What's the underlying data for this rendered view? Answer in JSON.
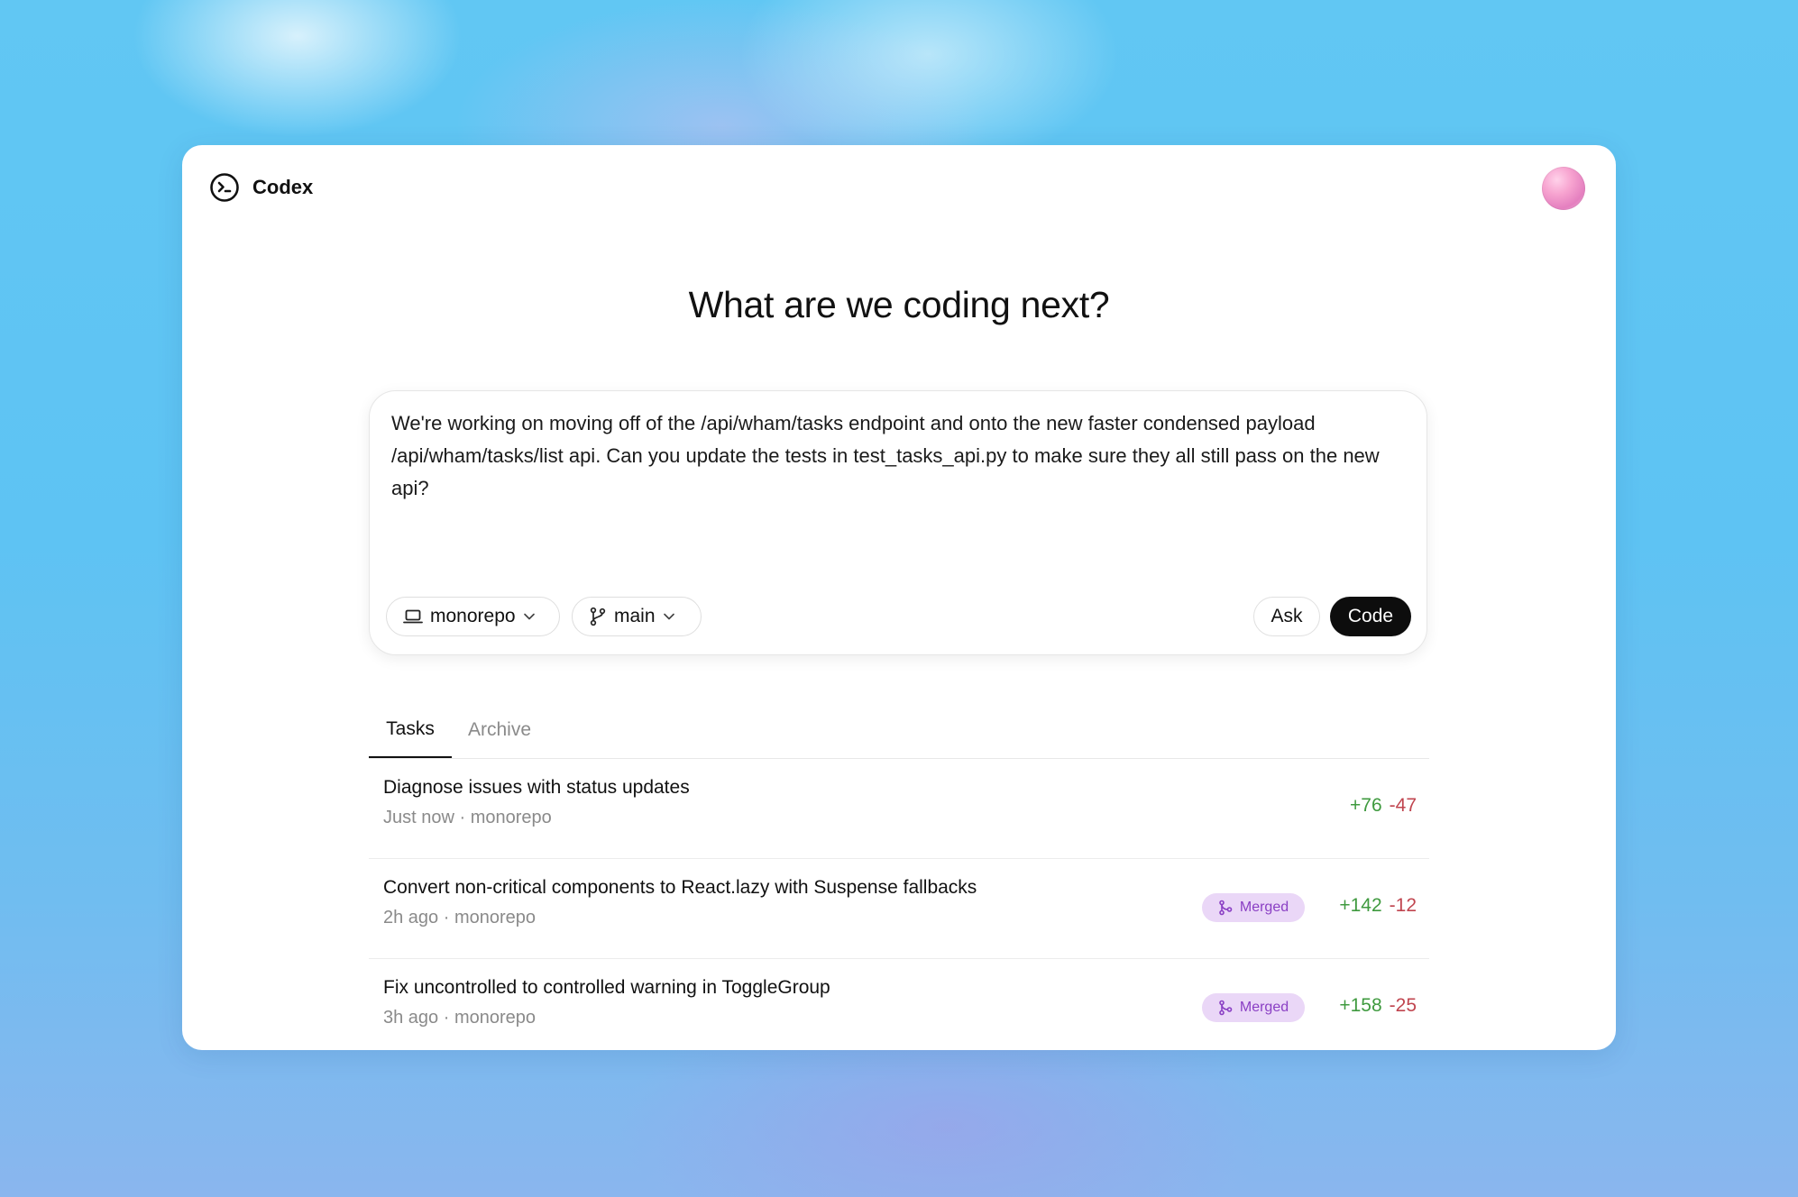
{
  "app": {
    "name": "Codex",
    "logo_icon": "terminal-circle-icon",
    "avatar_icon": "user-avatar"
  },
  "headline": "What are we coding next?",
  "composer": {
    "prompt": "We're working on moving off of the /api/wham/tasks endpoint and onto the new faster condensed payload /api/wham/tasks/list api. Can you update the tests in test_tasks_api.py to make sure they all still pass on the new api?",
    "repo": {
      "label": "monorepo",
      "icon": "laptop-icon"
    },
    "branch": {
      "label": "main",
      "icon": "git-branch-icon"
    },
    "ask_label": "Ask",
    "code_label": "Code"
  },
  "tabs": [
    {
      "label": "Tasks",
      "active": true
    },
    {
      "label": "Archive",
      "active": false
    }
  ],
  "tasks": [
    {
      "title": "Diagnose issues with status updates",
      "time": "Just now",
      "separator": "·",
      "repo": "monorepo",
      "status": "",
      "additions": "+76",
      "deletions": "-47"
    },
    {
      "title": "Convert non-critical components to React.lazy with Suspense fallbacks",
      "time": "2h ago",
      "separator": "·",
      "repo": "monorepo",
      "status": "Merged",
      "additions": "+142",
      "deletions": "-12"
    },
    {
      "title": "Fix uncontrolled to controlled warning in ToggleGroup",
      "time": "3h ago",
      "separator": "·",
      "repo": "monorepo",
      "status": "Merged",
      "additions": "+158",
      "deletions": "-25"
    }
  ],
  "colors": {
    "additions": "#3f9a3f",
    "deletions": "#c0454f",
    "merged_badge_bg": "#ead7f7",
    "merged_badge_text": "#8a3fc4",
    "primary_button": "#0d0d0d"
  }
}
